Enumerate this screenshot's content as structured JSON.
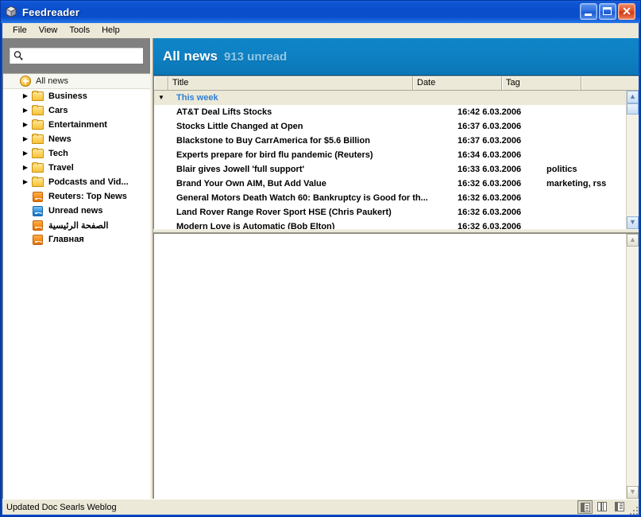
{
  "window": {
    "title": "Feedreader",
    "icon": "app-cube-icon",
    "buttons": {
      "minimize": "_",
      "maximize": "□",
      "close": "✕"
    }
  },
  "menubar": {
    "items": [
      {
        "label": "File"
      },
      {
        "label": "View"
      },
      {
        "label": "Tools"
      },
      {
        "label": "Help"
      }
    ]
  },
  "search": {
    "value": "",
    "placeholder": "",
    "icon": "search-magnifier-icon"
  },
  "sidebar": {
    "root": {
      "label": "All news",
      "icon": "all-news-icon"
    },
    "items": [
      {
        "label": "Business",
        "icon": "folder-icon",
        "expander": "▶",
        "type": "folder"
      },
      {
        "label": "Cars",
        "icon": "folder-icon",
        "expander": "▶",
        "type": "folder"
      },
      {
        "label": "Entertainment",
        "icon": "folder-icon",
        "expander": "▶",
        "type": "folder"
      },
      {
        "label": "News",
        "icon": "folder-icon",
        "expander": "▶",
        "type": "folder"
      },
      {
        "label": "Tech",
        "icon": "folder-icon",
        "expander": "▶",
        "type": "folder"
      },
      {
        "label": "Travel",
        "icon": "folder-icon",
        "expander": "▶",
        "type": "folder"
      },
      {
        "label": "Podcasts and Vid...",
        "icon": "folder-icon",
        "expander": "▶",
        "type": "folder"
      },
      {
        "label": "Reuters: Top News",
        "icon": "rss-icon",
        "expander": "",
        "type": "feed"
      },
      {
        "label": "Unread news",
        "icon": "rss-icon-blue",
        "expander": "",
        "type": "feed-special"
      },
      {
        "label": "الصفحة الرئيسية",
        "icon": "rss-icon",
        "expander": "",
        "type": "feed"
      },
      {
        "label": "Главная",
        "icon": "rss-icon",
        "expander": "",
        "type": "feed"
      }
    ]
  },
  "header": {
    "title": "All news",
    "unread": "913 unread"
  },
  "list": {
    "columns": [
      "",
      "Title",
      "Date",
      "Tag"
    ],
    "group": {
      "label": "This week",
      "expander": "▼"
    },
    "rows": [
      {
        "title": "AT&T Deal Lifts Stocks",
        "date": "16:42 6.03.2006",
        "tag": ""
      },
      {
        "title": "Stocks Little Changed at Open",
        "date": "16:37 6.03.2006",
        "tag": ""
      },
      {
        "title": "Blackstone to Buy CarrAmerica for $5.6 Billion",
        "date": "16:37 6.03.2006",
        "tag": ""
      },
      {
        "title": "Experts prepare for bird flu pandemic    (Reuters)",
        "date": "16:34 6.03.2006",
        "tag": ""
      },
      {
        "title": "Blair gives Jowell 'full support'",
        "date": "16:33 6.03.2006",
        "tag": "politics"
      },
      {
        "title": "Brand Your Own AIM, But Add Value",
        "date": "16:32 6.03.2006",
        "tag": "marketing, rss"
      },
      {
        "title": "General Motors Death Watch 60: Bankruptcy is Good for th...",
        "date": "16:32 6.03.2006",
        "tag": ""
      },
      {
        "title": "Land Rover Range Rover Sport HSE (Chris Paukert)",
        "date": "16:32 6.03.2006",
        "tag": ""
      },
      {
        "title": "Modern Love is Automatic (Bob Elton)",
        "date": "16:32 6.03.2006",
        "tag": ""
      }
    ]
  },
  "content": {
    "body": ""
  },
  "statusbar": {
    "text": "Updated Doc Searls Weblog",
    "view_buttons": [
      {
        "name": "layout-left-pane",
        "selected": true
      },
      {
        "name": "layout-three-column",
        "selected": false
      },
      {
        "name": "layout-right-pane",
        "selected": false
      }
    ]
  },
  "colors": {
    "title_bar": "#0b4ecb",
    "header_blue": "#0e80c2",
    "accent_group": "#2e7fd6",
    "chrome": "#ece9d8"
  }
}
